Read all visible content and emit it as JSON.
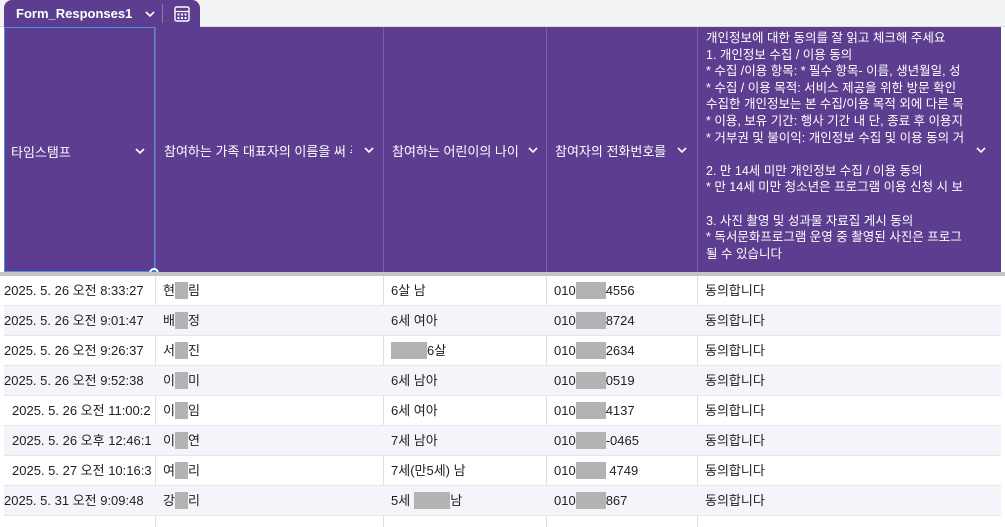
{
  "sheet_tab": {
    "name": "Form_Responses1"
  },
  "icons": {
    "chevron": "chevron-down-icon",
    "calculator": "calculator-icon"
  },
  "colors": {
    "header": "#5c3d8f",
    "band": "#f6f4fa",
    "redaction": "#b3b3b3",
    "selection": "#1a73e8"
  },
  "headers": {
    "timestamp": "타임스탬프",
    "representative_name": "참여하는 가족 대표자의 이름을 써 주",
    "child_age": "참여하는 어린이의 나이",
    "phone": "참여자의 전화번호를",
    "consent": "개인정보에 대한 동의를 잘 읽고 체크해 주세요\n1. 개인정보 수집 / 이용 동의\n* 수집 /이용 항목: * 필수 항목- 이름, 생년월일, 성\n* 수집 / 이용 목적: 서비스 제공을 위한 방문 확인\n수집한 개인정보는 본 수집/이용 목적 외에 다른 목\n* 이용, 보유 기간: 행사 기간 내 단, 종료 후 이용지\n* 거부권 및 불이익: 개인정보 수집 및 이용 동의 거\n\n2. 만 14세 미만 개인정보 수집 / 이용 동의\n* 만 14세 미만 청소년은 프로그램 이용 신청 시 보\n\n3. 사진 촬영 및 성과물 자료집 게시 동의\n* 독서문화프로그램 운영 중 촬영된 사진은 프로그\n될 수 있습니다"
  },
  "rows": [
    {
      "timestamp": "2025. 5. 26 오전 8:33:27",
      "name_first": "현",
      "name_last": "림",
      "age_pre": "6살 남",
      "age_post": "",
      "phone_prefix": "010",
      "phone_suffix": "4556",
      "consent": "동의합니다"
    },
    {
      "timestamp": "2025. 5. 26 오전 9:01:47",
      "name_first": "배",
      "name_last": "정",
      "age_pre": "6세 여아",
      "age_post": "",
      "phone_prefix": "010",
      "phone_suffix": "8724",
      "consent": "동의합니다"
    },
    {
      "timestamp": "2025. 5. 26 오전 9:26:37",
      "name_first": "서",
      "name_last": "진",
      "age_pre": "",
      "age_post": "6살",
      "phone_prefix": "010",
      "phone_suffix": "2634",
      "consent": "동의합니다"
    },
    {
      "timestamp": "2025. 5. 26 오전 9:52:38",
      "name_first": "이",
      "name_last": "미",
      "age_pre": "6세 남아",
      "age_post": "",
      "phone_prefix": "010",
      "phone_suffix": "0519",
      "consent": "동의합니다"
    },
    {
      "timestamp": "2025. 5. 26 오전 11:00:2",
      "name_first": "이",
      "name_last": "임",
      "age_pre": "6세 여아",
      "age_post": "",
      "phone_prefix": "010",
      "phone_suffix": "4137",
      "consent": "동의합니다"
    },
    {
      "timestamp": "2025. 5. 26 오후 12:46:1",
      "name_first": "이",
      "name_last": "연",
      "age_pre": "7세 남아",
      "age_post": "",
      "phone_prefix": "010",
      "phone_suffix": "-0465",
      "consent": "동의합니다"
    },
    {
      "timestamp": "2025. 5. 27 오전 10:16:3",
      "name_first": "여",
      "name_last": "리",
      "age_pre": "7세(만5세) 남",
      "age_post": "",
      "phone_prefix": "010",
      "phone_suffix": " 4749",
      "consent": "동의합니다"
    },
    {
      "timestamp": "2025. 5. 31 오전 9:09:48",
      "name_first": "강",
      "name_last": "리",
      "age_pre": "5세",
      "age_post": "남",
      "phone_prefix": "010",
      "phone_suffix": "867",
      "consent": "동의합니다"
    }
  ]
}
